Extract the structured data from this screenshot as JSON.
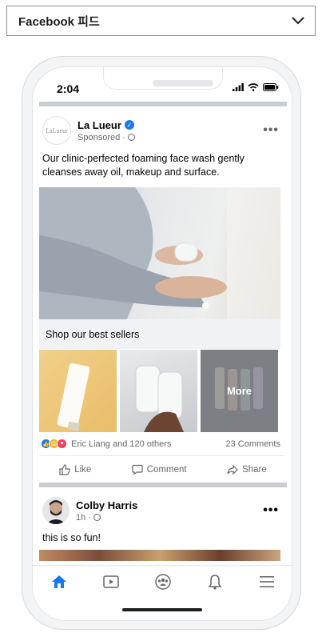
{
  "header": {
    "title": "Facebook 피드"
  },
  "status_bar": {
    "time": "2:04"
  },
  "post1": {
    "page_name": "La Lueur",
    "avatar_text": "LaLueur",
    "sponsored_label": "Sponsored",
    "text": "Our clinic-perfected foaming face wash gently cleanses away oil, makeup and surface.",
    "shop_label": "Shop our best sellers",
    "more_label": "More",
    "reactions_text": "Eric Liang and 120 others",
    "comments_count": "23 Comments",
    "actions": {
      "like": "Like",
      "comment": "Comment",
      "share": "Share"
    }
  },
  "post2": {
    "author": "Colby Harris",
    "time": "1h",
    "text": "this is so fun!"
  },
  "colors": {
    "accent": "#1877f2",
    "like": "#1877f2",
    "wow": "#f7b125",
    "love": "#f33e58"
  }
}
